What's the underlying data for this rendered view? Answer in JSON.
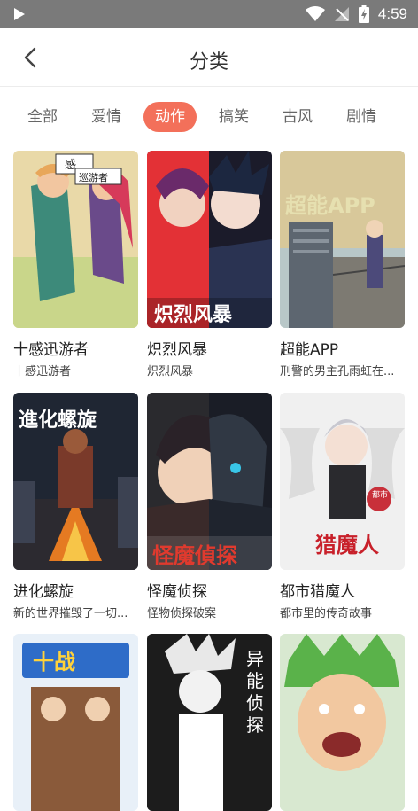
{
  "status_bar": {
    "time": "4:59"
  },
  "header": {
    "title": "分类"
  },
  "tabs": [
    {
      "label": "全部",
      "active": false
    },
    {
      "label": "爱情",
      "active": false
    },
    {
      "label": "动作",
      "active": true
    },
    {
      "label": "搞笑",
      "active": false
    },
    {
      "label": "古风",
      "active": false
    },
    {
      "label": "剧情",
      "active": false
    }
  ],
  "comics": [
    {
      "title": "十感迅游者",
      "desc": "十感迅游者",
      "cover_text": "十感 巡游者"
    },
    {
      "title": "炽烈风暴",
      "desc": "炽烈风暴",
      "cover_text": "炽烈风暴"
    },
    {
      "title": "超能APP",
      "desc": "刑警的男主孔雨虹在...",
      "cover_text": "超能APP"
    },
    {
      "title": "进化螺旋",
      "desc": "新的世界摧毁了一切...",
      "cover_text": "進化螺旋"
    },
    {
      "title": "怪魔侦探",
      "desc": "怪物侦探破案",
      "cover_text": "怪魔偵探"
    },
    {
      "title": "都市猎魔人",
      "desc": "都市里的传奇故事",
      "cover_text": "猎魔人"
    },
    {
      "title": "",
      "desc": "",
      "cover_text": ""
    },
    {
      "title": "",
      "desc": "",
      "cover_text": "异能侦探"
    },
    {
      "title": "",
      "desc": "",
      "cover_text": ""
    }
  ],
  "colors": {
    "accent": "#f3705a",
    "status_bar": "#7a7a7a"
  }
}
